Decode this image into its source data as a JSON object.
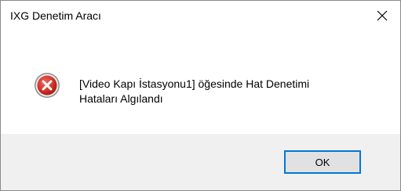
{
  "window": {
    "title": "IXG Denetim Aracı"
  },
  "icons": {
    "close": "close-icon",
    "error": "error-icon"
  },
  "dialog": {
    "message_line1": "[Video Kapı İstasyonu1] öğesinde Hat Denetimi",
    "message_line2": "Hataları Algılandı"
  },
  "buttons": {
    "ok_label": "OK"
  },
  "colors": {
    "accent": "#0078d7",
    "error_red": "#c42b1c",
    "footer_bg": "#f0f0f0"
  }
}
